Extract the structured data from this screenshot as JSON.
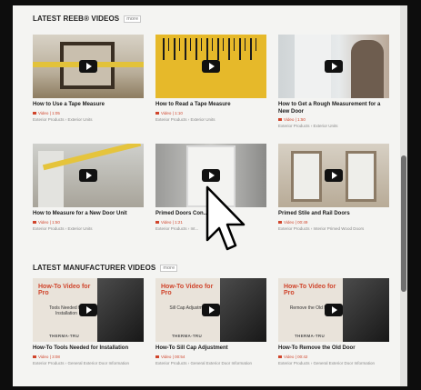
{
  "sections": {
    "reeb": {
      "title": "LATEST REEB® VIDEOS",
      "more": "more"
    },
    "manufacturer": {
      "title": "LATEST MANUFACTURER VIDEOS",
      "more": "more"
    }
  },
  "reeb_videos": [
    {
      "title": "How to Use a Tape Measure",
      "meta": "Video | 1:05",
      "crumbs": "Exterior Products › Exterior Units"
    },
    {
      "title": "How to Read a Tape Measure",
      "meta": "Video | 1:10",
      "crumbs": "Exterior Products › Exterior Units"
    },
    {
      "title": "How to Get a Rough Measurement for a New Door",
      "meta": "Video | 1:50",
      "crumbs": "Exterior Products › Exterior Units"
    },
    {
      "title": "How to Measure for a New Door Unit",
      "meta": "Video | 1:50",
      "crumbs": "Exterior Products › Exterior Units"
    },
    {
      "title": "Primed Doors Con...",
      "meta": "Video | 1:21",
      "crumbs": "Exterior Products › Int..."
    },
    {
      "title": "Primed Stile and Rail Doors",
      "meta": "Video | 00:49",
      "crumbs": "Exterior Products › Interior Primed Wood Doors"
    }
  ],
  "manufacturer_videos": [
    {
      "title": "How-To Tools Needed for Installation",
      "meta": "Video | 3:08",
      "crumbs": "Exterior Products › General Exterior Door Information",
      "thumb_heading": "How-To Video for Pro",
      "thumb_sub": "Tools Needed for Installation",
      "brand": "THERMA-TRU"
    },
    {
      "title": "How-To Sill Cap Adjustment",
      "meta": "Video | 00:54",
      "crumbs": "Exterior Products › General Exterior Door Information",
      "thumb_heading": "How-To Video for Pro",
      "thumb_sub": "Sill Cap Adjustment",
      "brand": "THERMA-TRU"
    },
    {
      "title": "How-To Remove the Old Door",
      "meta": "Video | 00:42",
      "crumbs": "Exterior Products › General Exterior Door Information",
      "thumb_heading": "How-To Video for Pro",
      "thumb_sub": "Remove the Old Door",
      "brand": "THERMA-TRU"
    }
  ],
  "colors": {
    "accent": "#d0452c",
    "page_bg": "#f4f4f2",
    "frame": "#0d0d0d"
  },
  "icons": {
    "play": "play-icon",
    "cursor": "mouse-pointer-icon"
  }
}
